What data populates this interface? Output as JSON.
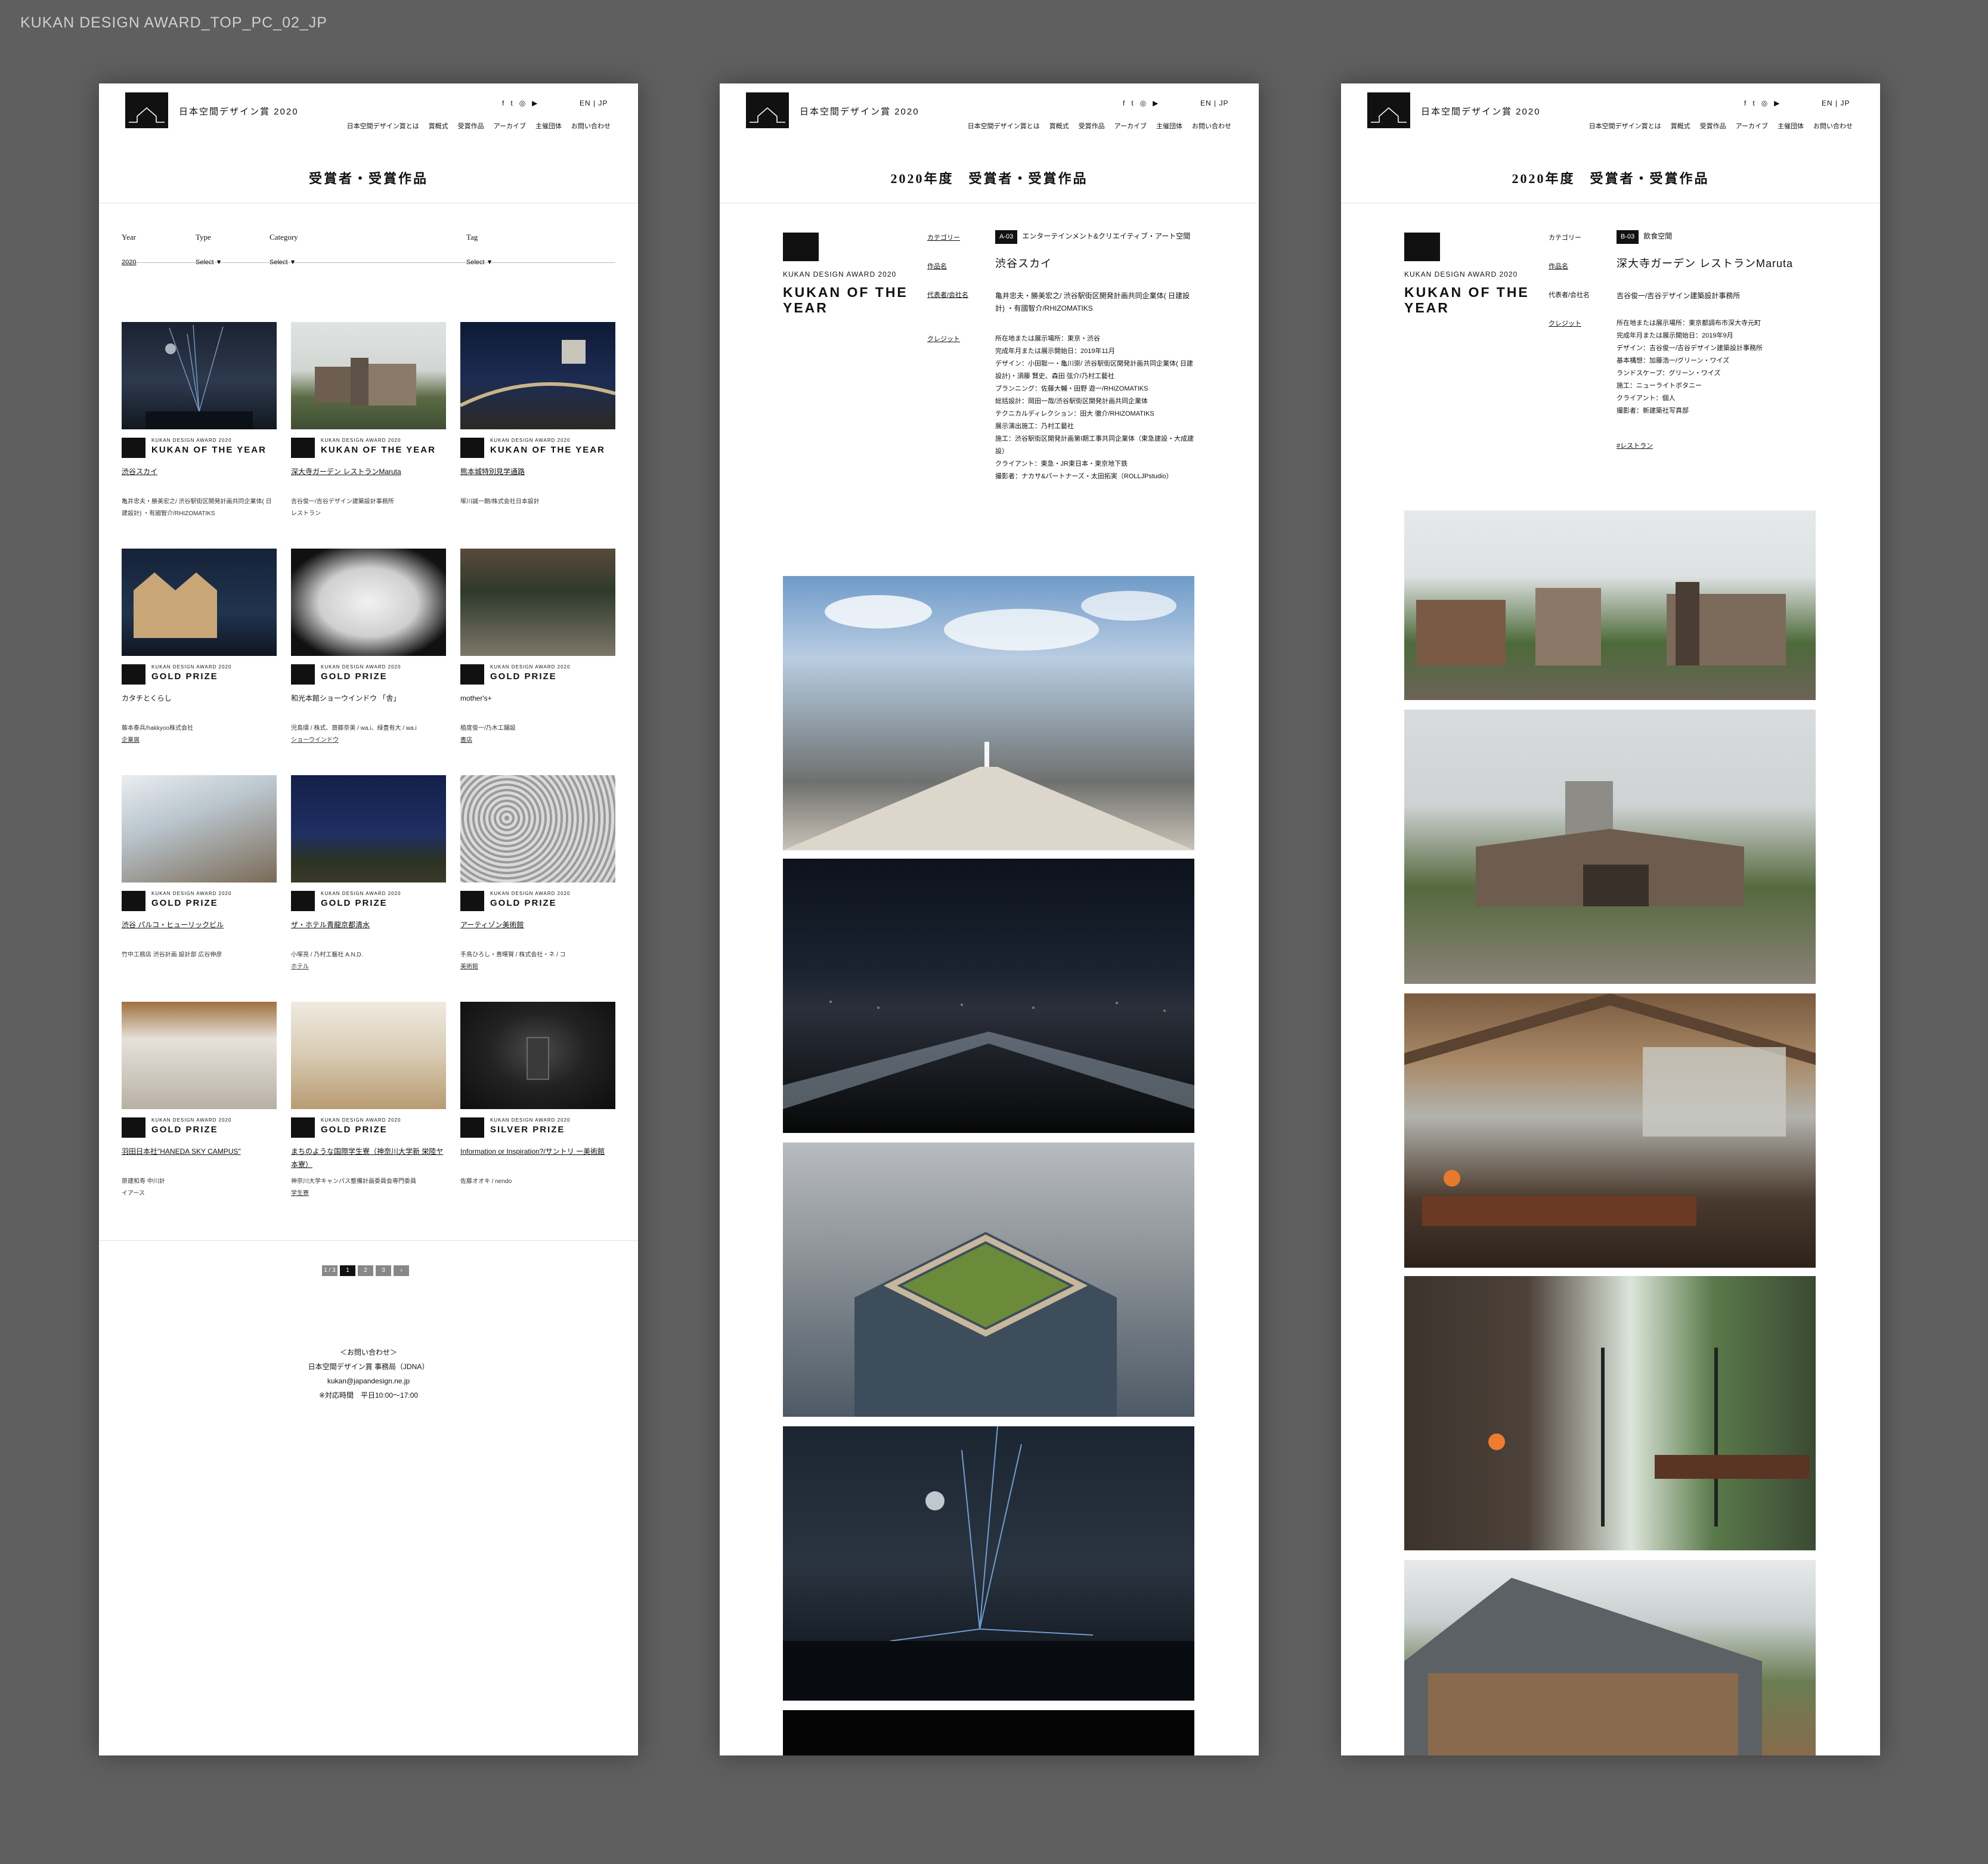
{
  "doc_label": "KUKAN DESIGN AWARD_TOP_PC_02_JP",
  "header": {
    "site_name": "日本空間デザイン賞 2020",
    "social": [
      "f",
      "t",
      "◎",
      "▶"
    ],
    "lang": "EN | JP",
    "nav": [
      "日本空間デザイン賞とは",
      "賞概式",
      "受賞作品",
      "アーカイブ",
      "主催団体",
      "お問い合わせ"
    ]
  },
  "list_page": {
    "title": "受賞者・受賞作品",
    "filters": {
      "year_label": "Year",
      "year_value": "2020",
      "type_label": "Type",
      "type_value": "Select",
      "category_label": "Category",
      "category_value": "Select",
      "tag_label": "Tag",
      "tag_value": "Select"
    },
    "cards": [
      {
        "award_small": "KUKAN DESIGN AWARD 2020",
        "award": "KUKAN OF THE YEAR",
        "title": "渋谷スカイ",
        "meta1": "亀井忠夫・勝美宏之/ 渋谷駅街区開発計画共同企業体( 日建設計) ・有國智介/RHIZOMATIKS",
        "meta2": ""
      },
      {
        "award_small": "KUKAN DESIGN AWARD 2020",
        "award": "KUKAN OF THE YEAR",
        "title": "深大寺ガーデン レストランMaruta",
        "meta1": "吉谷俊一/吉谷デザイン建築設計事務所",
        "meta2": "レストラン"
      },
      {
        "award_small": "KUKAN DESIGN AWARD 2020",
        "award": "KUKAN OF THE YEAR",
        "title": "熊本城特別見学通路",
        "meta1": "塚川誠一朗/株式会社日本設計",
        "meta2": ""
      },
      {
        "award_small": "KUKAN DESIGN AWARD 2020",
        "award": "GOLD PRIZE",
        "title": "カタチとくらし",
        "meta1": "藤本泰兵/hakkyoo株式会社",
        "meta2": "企業展"
      },
      {
        "award_small": "KUKAN DESIGN AWARD 2020",
        "award": "GOLD PRIZE",
        "title": "和光本館ショーウインドウ 「舎」",
        "meta1": "児島環 / 株式、齋藤奈美 / wa.i、緑豊有大 / wa.i",
        "meta2": "ショーウインドウ"
      },
      {
        "award_small": "KUKAN DESIGN AWARD 2020",
        "award": "GOLD PRIZE",
        "title": "mother's+",
        "meta1": "植度俊一/乃木工舗設",
        "meta2": "書店"
      },
      {
        "award_small": "KUKAN DESIGN AWARD 2020",
        "award": "GOLD PRIZE",
        "title": "渋谷 パルコ・ヒューリックビル",
        "meta1": "竹中工務店 渋谷計画 設計部 広谷伸彦",
        "meta2": ""
      },
      {
        "award_small": "KUKAN DESIGN AWARD 2020",
        "award": "GOLD PRIZE",
        "title": "ザ・ホテル青龍京都清水",
        "meta1": "小塚亮 / 乃村工藝社 A.N.D.",
        "meta2": "ホテル"
      },
      {
        "award_small": "KUKAN DESIGN AWARD 2020",
        "award": "GOLD PRIZE",
        "title": "アーティゾン美術館",
        "meta1": "手鳥ひろし・貴暉賀 / 株式会社・ネ / コ",
        "meta2": "美術館"
      },
      {
        "award_small": "KUKAN DESIGN AWARD 2020",
        "award": "GOLD PRIZE",
        "title": "羽田日本社\"HANEDA SKY CAMPUS\"",
        "meta1": "原建和寿 中川計",
        "meta2": "イアース"
      },
      {
        "award_small": "KUKAN DESIGN AWARD 2020",
        "award": "GOLD PRIZE",
        "title": "まちのような国際学生寮（神奈川大学新 栄陸ヤ本寮）",
        "meta1": "神奈川大学キャンパス整備計画委員会専門委員",
        "meta2": "学生寮"
      },
      {
        "award_small": "KUKAN DESIGN AWARD 2020",
        "award": "SILVER PRIZE",
        "title": "Information or Inspiration?/サントリ ー美術館",
        "meta1": "佐藤オオキ / nendo",
        "meta2": ""
      }
    ],
    "pager": [
      "1 / 3",
      "1",
      "2",
      "3",
      "›"
    ],
    "contact": [
      "＜お問い合わせ＞",
      "日本空間デザイン賞 事務局（JDNA）",
      "kukan@japandesign.ne.jp",
      "※対応時間　平日10:00～17:00"
    ]
  },
  "detail1": {
    "title": "2020年度　受賞者・受賞作品",
    "badge_small": "KUKAN DESIGN AWARD 2020",
    "badge_big": "KUKAN OF THE YEAR",
    "labels": {
      "category": "カテゴリー",
      "work": "作品名",
      "designer": "代表者/会社名",
      "credit": "クレジット"
    },
    "category_code": "A-03",
    "category_name": "エンターテインメント&クリエイティブ・アート空間",
    "work_name": "渋谷スカイ",
    "designer": "亀井忠夫・勝美宏之/ 渋谷駅街区開発計画共同企業体( 日建設計) ・有國智介/RHIZOMATIKS",
    "credits": [
      "所在地または展示場所：東京・渋谷",
      "完成年月または展示開始日：2019年11月",
      "デザイン：小田聡一・亀川崇/ 渋谷駅街区開発計画共同企業体( 日建設計)・須藤 賢史、森田 弦介/乃村工藝社",
      "プランニング：佐藤大輔・田野 遊一/RHIZOMATIKS",
      "総括設計：岡田一哉/渋谷駅街区開発計画共同企業体",
      "テクニカルディレクション：田大 徹介/RHIZOMATIKS",
      "展示演出施工：乃村工藝社",
      "施工：渋谷駅街区開発計画第I期工事共同企業体（東急建設・大成建設）",
      "クライアント：東急・JR東日本・東京地下鉄",
      "撮影者：ナカサ&パートナーズ・太田拓実（ROLLJPstudio）"
    ]
  },
  "detail2": {
    "title": "2020年度　受賞者・受賞作品",
    "badge_small": "KUKAN DESIGN AWARD 2020",
    "badge_big": "KUKAN OF THE YEAR",
    "labels": {
      "category": "カテゴリー",
      "work": "作品名",
      "designer": "代表者/会社名",
      "credit": "クレジット"
    },
    "category_code": "B-03",
    "category_name": "飲食空間",
    "work_name": "深大寺ガーデン レストランMaruta",
    "designer": "吉谷俊一/吉谷デザイン建築設計事務所",
    "credits": [
      "所在地または展示場所：東京都調布市深大寺元町",
      "完成年月または展示開始日：2019年9月",
      "デザイン：吉谷俊一/吉谷デザイン建築設計事務所",
      "基本構想：加藤浩一/グリーン・ワイズ",
      "ランドスケープ：グリーン・ワイズ",
      "施工：ニューライトボタニー",
      "クライアント：個人",
      "撮影者：新建築社写真部"
    ],
    "tag": "#レストラン"
  }
}
